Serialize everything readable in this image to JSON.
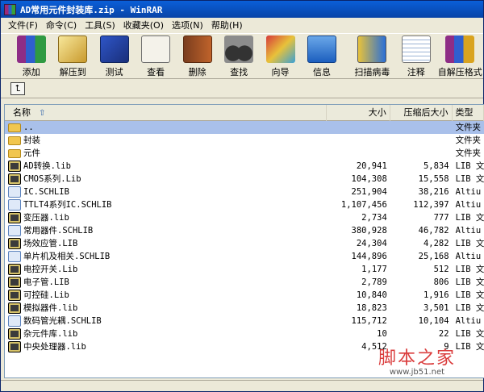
{
  "window": {
    "title": "AD常用元件封装库.zip - WinRAR"
  },
  "menu": [
    {
      "label": "文件(F)"
    },
    {
      "label": "命令(C)"
    },
    {
      "label": "工具(S)"
    },
    {
      "label": "收藏夹(O)"
    },
    {
      "label": "选项(N)"
    },
    {
      "label": "帮助(H)"
    }
  ],
  "toolbar": [
    {
      "label": "添加",
      "icon": "add-books-icon"
    },
    {
      "label": "解压到",
      "icon": "extract-icon"
    },
    {
      "label": "测试",
      "icon": "test-icon"
    },
    {
      "label": "查看",
      "icon": "view-icon"
    },
    {
      "label": "删除",
      "icon": "delete-icon"
    },
    {
      "label": "查找",
      "icon": "find-binoculars-icon"
    },
    {
      "label": "向导",
      "icon": "wizard-icon"
    },
    {
      "label": "信息",
      "icon": "info-icon"
    },
    {
      "label": "扫描病毒",
      "icon": "virus-scan-icon"
    },
    {
      "label": "注释",
      "icon": "comment-icon"
    },
    {
      "label": "自解压格式",
      "icon": "sfx-icon"
    }
  ],
  "address": {
    "up_icon": "up-folder-icon"
  },
  "columns": {
    "name": "名称",
    "size": "大小",
    "packed": "压缩后大小",
    "type": "类型"
  },
  "files": [
    {
      "name": "..",
      "size": "",
      "packed": "",
      "type": "文件夹",
      "kind": "folder",
      "selected": true
    },
    {
      "name": "封装",
      "size": "",
      "packed": "",
      "type": "文件夹",
      "kind": "folder"
    },
    {
      "name": "元件",
      "size": "",
      "packed": "",
      "type": "文件夹",
      "kind": "folder"
    },
    {
      "name": "AD转换.lib",
      "size": "20,941",
      "packed": "5,834",
      "type": "LIB 文",
      "kind": "lib"
    },
    {
      "name": "CMOS系列.Lib",
      "size": "104,308",
      "packed": "15,558",
      "type": "LIB 文",
      "kind": "lib"
    },
    {
      "name": "IC.SCHLIB",
      "size": "251,904",
      "packed": "38,216",
      "type": "Altiu",
      "kind": "schlib"
    },
    {
      "name": "TTLT4系列IC.SCHLIB",
      "size": "1,107,456",
      "packed": "112,397",
      "type": "Altiu",
      "kind": "schlib"
    },
    {
      "name": "变压器.lib",
      "size": "2,734",
      "packed": "777",
      "type": "LIB 文",
      "kind": "lib"
    },
    {
      "name": "常用器件.SCHLIB",
      "size": "380,928",
      "packed": "46,782",
      "type": "Altiu",
      "kind": "schlib"
    },
    {
      "name": "场效应管.LIB",
      "size": "24,304",
      "packed": "4,282",
      "type": "LIB 文",
      "kind": "lib"
    },
    {
      "name": "单片机及相关.SCHLIB",
      "size": "144,896",
      "packed": "25,168",
      "type": "Altiu",
      "kind": "schlib"
    },
    {
      "name": "电控开关.Lib",
      "size": "1,177",
      "packed": "512",
      "type": "LIB 文",
      "kind": "lib"
    },
    {
      "name": "电子管.LIB",
      "size": "2,789",
      "packed": "806",
      "type": "LIB 文",
      "kind": "lib"
    },
    {
      "name": "可控硅.Lib",
      "size": "10,840",
      "packed": "1,916",
      "type": "LIB 文",
      "kind": "lib"
    },
    {
      "name": "模拟器件.lib",
      "size": "18,823",
      "packed": "3,501",
      "type": "LIB 文",
      "kind": "lib"
    },
    {
      "name": "数码管光耦.SCHLIB",
      "size": "115,712",
      "packed": "10,104",
      "type": "Altiu",
      "kind": "schlib"
    },
    {
      "name": "杂元件库.lib",
      "size": "10",
      "packed": "22",
      "type": "LIB 文",
      "kind": "lib"
    },
    {
      "name": "中央处理器.lib",
      "size": "4,512",
      "packed": "9",
      "type": "LIB 文",
      "kind": "lib"
    }
  ],
  "watermark": {
    "main": "脚本之家",
    "sub": "www.jb51.net"
  }
}
